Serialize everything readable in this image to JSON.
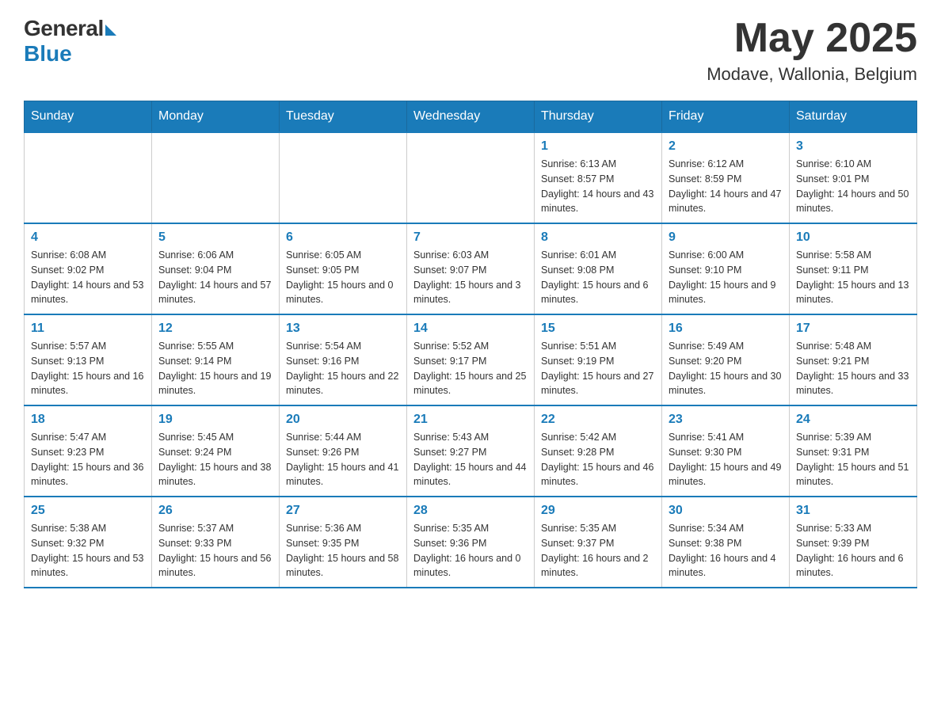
{
  "header": {
    "logo_general": "General",
    "logo_blue": "Blue",
    "month_year": "May 2025",
    "location": "Modave, Wallonia, Belgium"
  },
  "days_of_week": [
    "Sunday",
    "Monday",
    "Tuesday",
    "Wednesday",
    "Thursday",
    "Friday",
    "Saturday"
  ],
  "weeks": [
    [
      {
        "day": "",
        "info": ""
      },
      {
        "day": "",
        "info": ""
      },
      {
        "day": "",
        "info": ""
      },
      {
        "day": "",
        "info": ""
      },
      {
        "day": "1",
        "info": "Sunrise: 6:13 AM\nSunset: 8:57 PM\nDaylight: 14 hours and 43 minutes."
      },
      {
        "day": "2",
        "info": "Sunrise: 6:12 AM\nSunset: 8:59 PM\nDaylight: 14 hours and 47 minutes."
      },
      {
        "day": "3",
        "info": "Sunrise: 6:10 AM\nSunset: 9:01 PM\nDaylight: 14 hours and 50 minutes."
      }
    ],
    [
      {
        "day": "4",
        "info": "Sunrise: 6:08 AM\nSunset: 9:02 PM\nDaylight: 14 hours and 53 minutes."
      },
      {
        "day": "5",
        "info": "Sunrise: 6:06 AM\nSunset: 9:04 PM\nDaylight: 14 hours and 57 minutes."
      },
      {
        "day": "6",
        "info": "Sunrise: 6:05 AM\nSunset: 9:05 PM\nDaylight: 15 hours and 0 minutes."
      },
      {
        "day": "7",
        "info": "Sunrise: 6:03 AM\nSunset: 9:07 PM\nDaylight: 15 hours and 3 minutes."
      },
      {
        "day": "8",
        "info": "Sunrise: 6:01 AM\nSunset: 9:08 PM\nDaylight: 15 hours and 6 minutes."
      },
      {
        "day": "9",
        "info": "Sunrise: 6:00 AM\nSunset: 9:10 PM\nDaylight: 15 hours and 9 minutes."
      },
      {
        "day": "10",
        "info": "Sunrise: 5:58 AM\nSunset: 9:11 PM\nDaylight: 15 hours and 13 minutes."
      }
    ],
    [
      {
        "day": "11",
        "info": "Sunrise: 5:57 AM\nSunset: 9:13 PM\nDaylight: 15 hours and 16 minutes."
      },
      {
        "day": "12",
        "info": "Sunrise: 5:55 AM\nSunset: 9:14 PM\nDaylight: 15 hours and 19 minutes."
      },
      {
        "day": "13",
        "info": "Sunrise: 5:54 AM\nSunset: 9:16 PM\nDaylight: 15 hours and 22 minutes."
      },
      {
        "day": "14",
        "info": "Sunrise: 5:52 AM\nSunset: 9:17 PM\nDaylight: 15 hours and 25 minutes."
      },
      {
        "day": "15",
        "info": "Sunrise: 5:51 AM\nSunset: 9:19 PM\nDaylight: 15 hours and 27 minutes."
      },
      {
        "day": "16",
        "info": "Sunrise: 5:49 AM\nSunset: 9:20 PM\nDaylight: 15 hours and 30 minutes."
      },
      {
        "day": "17",
        "info": "Sunrise: 5:48 AM\nSunset: 9:21 PM\nDaylight: 15 hours and 33 minutes."
      }
    ],
    [
      {
        "day": "18",
        "info": "Sunrise: 5:47 AM\nSunset: 9:23 PM\nDaylight: 15 hours and 36 minutes."
      },
      {
        "day": "19",
        "info": "Sunrise: 5:45 AM\nSunset: 9:24 PM\nDaylight: 15 hours and 38 minutes."
      },
      {
        "day": "20",
        "info": "Sunrise: 5:44 AM\nSunset: 9:26 PM\nDaylight: 15 hours and 41 minutes."
      },
      {
        "day": "21",
        "info": "Sunrise: 5:43 AM\nSunset: 9:27 PM\nDaylight: 15 hours and 44 minutes."
      },
      {
        "day": "22",
        "info": "Sunrise: 5:42 AM\nSunset: 9:28 PM\nDaylight: 15 hours and 46 minutes."
      },
      {
        "day": "23",
        "info": "Sunrise: 5:41 AM\nSunset: 9:30 PM\nDaylight: 15 hours and 49 minutes."
      },
      {
        "day": "24",
        "info": "Sunrise: 5:39 AM\nSunset: 9:31 PM\nDaylight: 15 hours and 51 minutes."
      }
    ],
    [
      {
        "day": "25",
        "info": "Sunrise: 5:38 AM\nSunset: 9:32 PM\nDaylight: 15 hours and 53 minutes."
      },
      {
        "day": "26",
        "info": "Sunrise: 5:37 AM\nSunset: 9:33 PM\nDaylight: 15 hours and 56 minutes."
      },
      {
        "day": "27",
        "info": "Sunrise: 5:36 AM\nSunset: 9:35 PM\nDaylight: 15 hours and 58 minutes."
      },
      {
        "day": "28",
        "info": "Sunrise: 5:35 AM\nSunset: 9:36 PM\nDaylight: 16 hours and 0 minutes."
      },
      {
        "day": "29",
        "info": "Sunrise: 5:35 AM\nSunset: 9:37 PM\nDaylight: 16 hours and 2 minutes."
      },
      {
        "day": "30",
        "info": "Sunrise: 5:34 AM\nSunset: 9:38 PM\nDaylight: 16 hours and 4 minutes."
      },
      {
        "day": "31",
        "info": "Sunrise: 5:33 AM\nSunset: 9:39 PM\nDaylight: 16 hours and 6 minutes."
      }
    ]
  ]
}
